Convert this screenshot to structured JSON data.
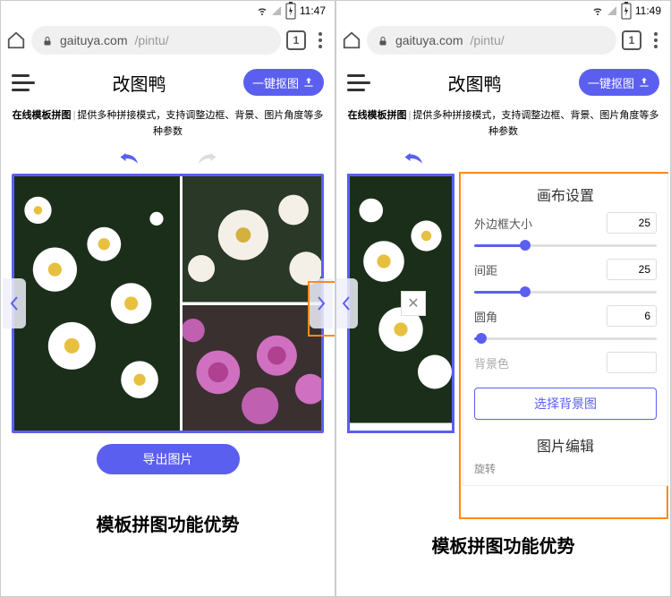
{
  "screen1": {
    "status": {
      "time": "11:47"
    },
    "browser": {
      "host": "gaituya.com",
      "path": "/pintu/",
      "tab_count": "1"
    },
    "header": {
      "title": "改图鸭",
      "cta": "一键抠图"
    },
    "subtitle": {
      "bold": "在线模板拼图",
      "rest": "提供多种拼接模式，支持调整边框、背景、图片角度等多种参数"
    },
    "export": "导出图片",
    "footer": "模板拼图功能优势"
  },
  "screen2": {
    "status": {
      "time": "11:49"
    },
    "browser": {
      "host": "gaituya.com",
      "path": "/pintu/",
      "tab_count": "1"
    },
    "header": {
      "title": "改图鸭",
      "cta": "一键抠图"
    },
    "subtitle": {
      "bold": "在线模板拼图",
      "rest": "提供多种拼接模式，支持调整边框、背景、图片角度等多种参数"
    },
    "panel": {
      "title": "画布设置",
      "border_label": "外边框大小",
      "border_value": "25",
      "border_pct": 28,
      "gap_label": "间距",
      "gap_value": "25",
      "gap_pct": 28,
      "radius_label": "圆角",
      "radius_value": "6",
      "radius_pct": 4,
      "bg_label": "背景色",
      "bg_btn": "选择背景图",
      "sub_title": "图片编辑",
      "cut_label": "旋转"
    },
    "footer": "模板拼图功能优势"
  }
}
